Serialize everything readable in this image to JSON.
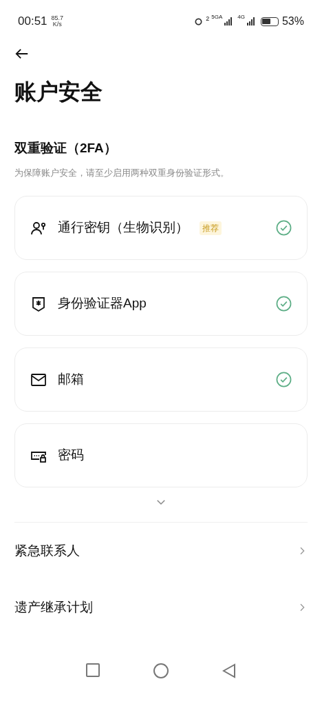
{
  "status_bar": {
    "time": "00:51",
    "speed_value": "85.7",
    "speed_unit": "K/s",
    "sim_number": "2",
    "network_1": "5GA",
    "network_2": "4G",
    "battery": "53%"
  },
  "page": {
    "title": "账户安全"
  },
  "two_factor": {
    "heading": "双重验证（2FA）",
    "description": "为保障账户安全，请至少启用两种双重身份验证形式。",
    "methods": [
      {
        "kind": "passkey",
        "label": "通行密钥（生物识别）",
        "badge": "推荐",
        "enabled": true
      },
      {
        "kind": "authenticator",
        "label": "身份验证器App",
        "enabled": true
      },
      {
        "kind": "email",
        "label": "邮箱",
        "enabled": true
      },
      {
        "kind": "password",
        "label": "密码",
        "enabled": false
      }
    ],
    "expanded": false
  },
  "settings": [
    {
      "label": "紧急联系人"
    },
    {
      "label": "遗产继承计划"
    }
  ]
}
